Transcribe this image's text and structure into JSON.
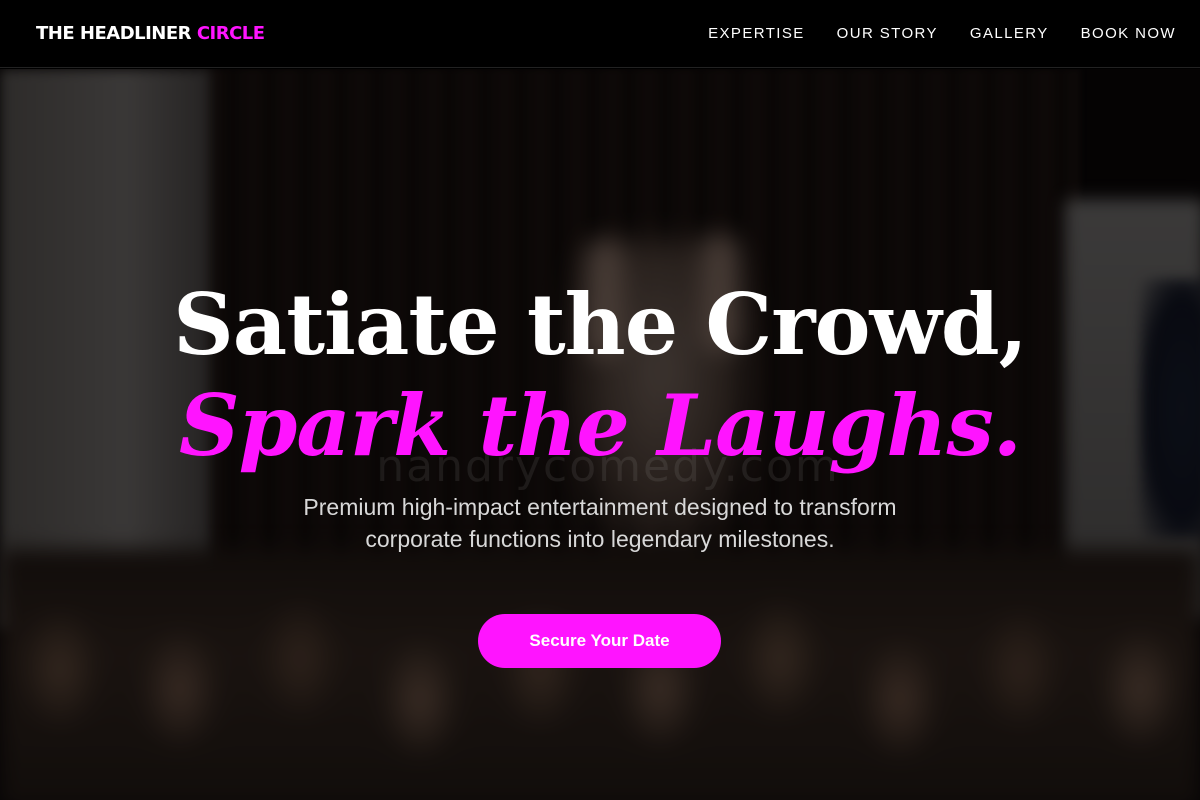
{
  "header": {
    "logo_primary": "THE HEADLINER",
    "logo_accent": "CIRCLE",
    "nav": [
      {
        "label": "EXPERTISE"
      },
      {
        "label": "OUR STORY"
      },
      {
        "label": "GALLERY"
      },
      {
        "label": "BOOK NOW"
      }
    ]
  },
  "hero": {
    "headline_line1": "Satiate the Crowd,",
    "headline_line2": "Spark the Laughs.",
    "subtitle": "Premium high-impact entertainment designed to transform corporate functions into legendary milestones.",
    "cta_label": "Secure Your Date",
    "watermark": "nandrycomedy.com"
  },
  "colors": {
    "accent": "#ff14ff",
    "header_bg": "#000000",
    "text": "#ffffff"
  }
}
